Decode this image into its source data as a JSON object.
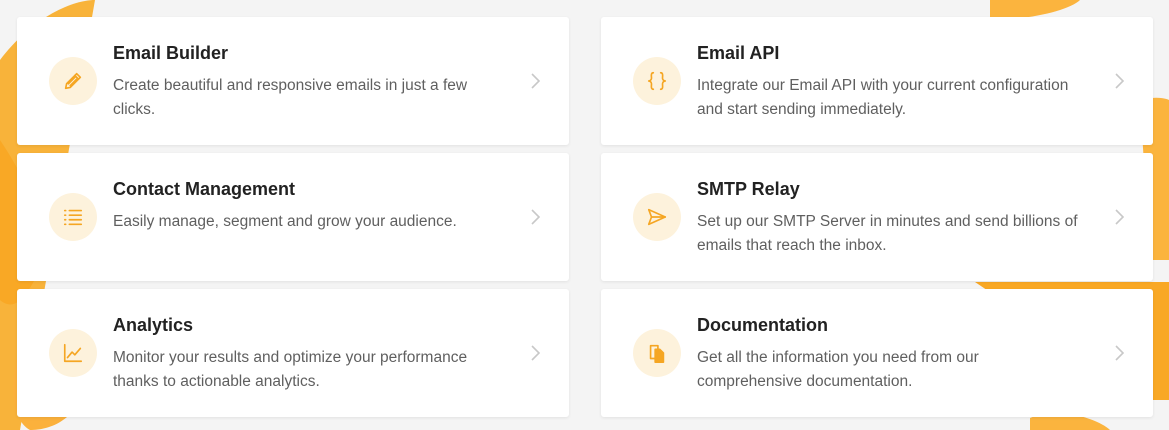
{
  "accent_color": "#f5a623",
  "cards": [
    {
      "title": "Email Builder",
      "description": "Create beautiful and responsive emails in just a few clicks.",
      "icon": "pencil-icon"
    },
    {
      "title": "Email API",
      "description": "Integrate our Email API with your current configuration and start sending immediately.",
      "icon": "braces-icon"
    },
    {
      "title": "Contact Management",
      "description": "Easily manage, segment and grow your audience.",
      "icon": "list-icon"
    },
    {
      "title": "SMTP Relay",
      "description": "Set up our SMTP Server in minutes and send billions of emails that reach the inbox.",
      "icon": "send-icon"
    },
    {
      "title": "Analytics",
      "description": "Monitor your results and optimize your performance thanks to actionable analytics.",
      "icon": "chart-line-icon"
    },
    {
      "title": "Documentation",
      "description": "Get all the information you need from our comprehensive documentation.",
      "icon": "documents-icon"
    }
  ]
}
